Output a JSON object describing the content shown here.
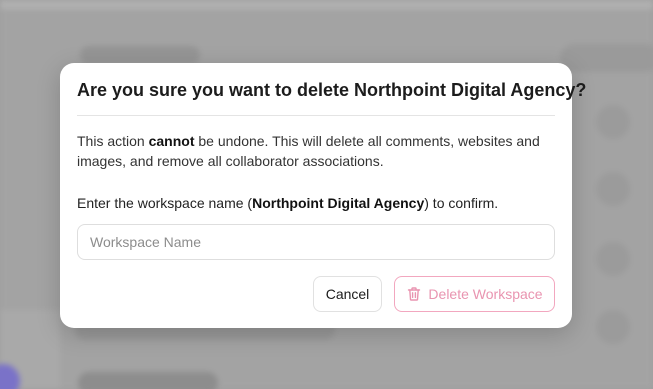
{
  "dialog": {
    "title": "Are you sure you want to delete Northpoint Digital Agency?",
    "description_prefix": "This action ",
    "description_emphasis": "cannot",
    "description_suffix": " be undone. This will delete all comments, websites and images, and remove all collaborator associations.",
    "confirm_prefix": "Enter the workspace name (",
    "workspace_name": "Northpoint Digital Agency",
    "confirm_suffix": ") to confirm.",
    "input": {
      "placeholder": "Workspace Name",
      "value": ""
    },
    "buttons": {
      "cancel_label": "Cancel",
      "delete_label": "Delete Workspace",
      "delete_icon": "trash-icon"
    }
  },
  "colors": {
    "delete_accent": "#e994b0",
    "delete_border": "#f2a7bf",
    "overlay": "#a3a3a3"
  }
}
